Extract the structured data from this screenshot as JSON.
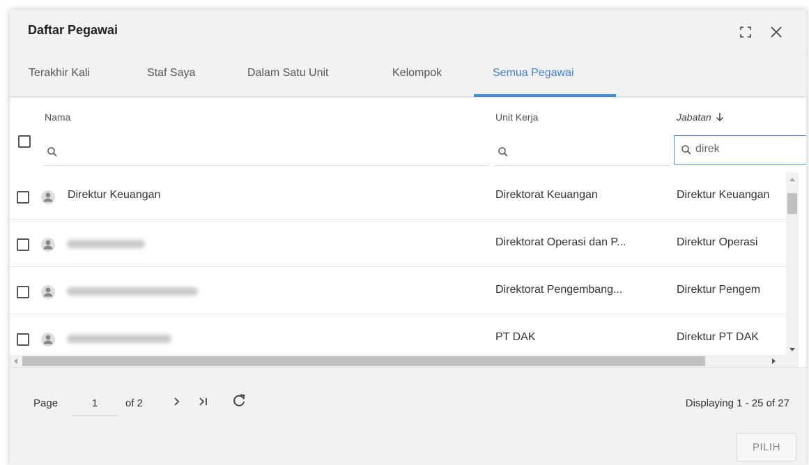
{
  "dialog": {
    "title": "Daftar Pegawai"
  },
  "tabs": [
    {
      "label": "Terakhir Kali",
      "active": false
    },
    {
      "label": "Staf Saya",
      "active": false
    },
    {
      "label": "Dalam Satu Unit",
      "active": false
    },
    {
      "label": "Kelompok",
      "active": false
    },
    {
      "label": "Semua Pegawai",
      "active": true
    }
  ],
  "columns": {
    "name": "Nama",
    "unit": "Unit Kerja",
    "jabatan": "Jabatan",
    "jabatan_sort": "descending"
  },
  "filters": {
    "jabatan_value": "direk"
  },
  "rows": [
    {
      "name": "Direktur Keuangan",
      "name_visible": true,
      "unit": "Direktorat Keuangan",
      "jabatan": "Direktur Keuangan"
    },
    {
      "name": "",
      "name_visible": false,
      "unit": "Direktorat Operasi dan P...",
      "jabatan": "Direktur Operasi"
    },
    {
      "name": "",
      "name_visible": false,
      "unit": "Direktorat Pengembang...",
      "jabatan": "Direktur Pengem"
    },
    {
      "name": "",
      "name_visible": false,
      "unit": "PT DAK",
      "jabatan": "Direktur PT DAK"
    }
  ],
  "pager": {
    "page_label": "Page",
    "current_page": "1",
    "of_label": "of 2",
    "display_text": "Displaying 1 - 25 of 27"
  },
  "actions": {
    "pilih_label": "PILIH"
  },
  "colors": {
    "accent": "#3f80d8",
    "header_bg": "#f2f2f2"
  }
}
